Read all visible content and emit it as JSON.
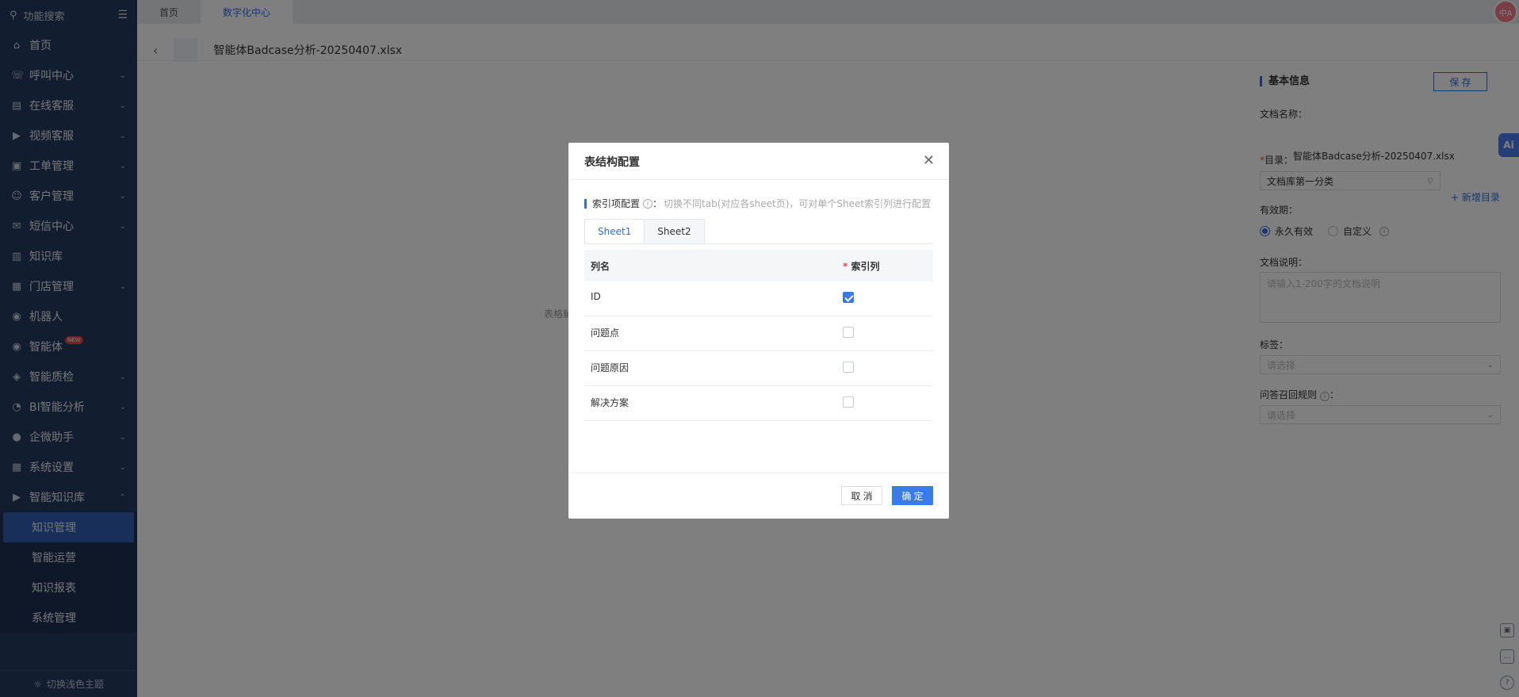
{
  "sidebar": {
    "search_label": "功能搜索",
    "items": [
      {
        "label": "首页",
        "icon": "home-icon",
        "glyph": "⌂",
        "chev": ""
      },
      {
        "label": "呼叫中心",
        "icon": "phone-icon",
        "glyph": "☏",
        "chev": "⌄"
      },
      {
        "label": "在线客服",
        "icon": "chat-icon",
        "glyph": "▤",
        "chev": "⌄"
      },
      {
        "label": "视频客服",
        "icon": "video-icon",
        "glyph": "▶",
        "chev": "⌄"
      },
      {
        "label": "工单管理",
        "icon": "ticket-icon",
        "glyph": "▣",
        "chev": "⌄"
      },
      {
        "label": "客户管理",
        "icon": "users-icon",
        "glyph": "☺",
        "chev": "⌄"
      },
      {
        "label": "短信中心",
        "icon": "mail-icon",
        "glyph": "✉",
        "chev": "⌄"
      },
      {
        "label": "知识库",
        "icon": "books-icon",
        "glyph": "▥",
        "chev": ""
      },
      {
        "label": "门店管理",
        "icon": "store-icon",
        "glyph": "▦",
        "chev": "⌄"
      },
      {
        "label": "机器人",
        "icon": "robot-icon",
        "glyph": "◉",
        "chev": ""
      },
      {
        "label": "智能体",
        "icon": "agent-icon",
        "glyph": "◉",
        "chev": "",
        "badge": "NEW"
      },
      {
        "label": "智能质检",
        "icon": "quality-icon",
        "glyph": "◈",
        "chev": "⌄"
      },
      {
        "label": "BI智能分析",
        "icon": "pie-chart-icon",
        "glyph": "◔",
        "chev": "⌄"
      },
      {
        "label": "企微助手",
        "icon": "wechat-icon",
        "glyph": "●",
        "chev": "⌄"
      },
      {
        "label": "系统设置",
        "icon": "settings-grid-icon",
        "glyph": "▦",
        "chev": "⌄"
      },
      {
        "label": "智能知识库",
        "icon": "knowledge-icon",
        "glyph": "▶",
        "chev": "⌃"
      }
    ],
    "sub_items": [
      {
        "label": "知识管理",
        "active": true
      },
      {
        "label": "智能运营",
        "active": false
      },
      {
        "label": "知识报表",
        "active": false
      },
      {
        "label": "系统管理",
        "active": false
      }
    ],
    "footer_label": "切换浅色主题"
  },
  "tabs": [
    {
      "label": "首页",
      "active": false
    },
    {
      "label": "数字化中心",
      "active": true
    }
  ],
  "avatar_text": "中A",
  "document": {
    "title": "智能体Badcase分析-20250407.xlsx",
    "preview_hint": "表格解"
  },
  "right_panel": {
    "section_title": "基本信息",
    "save_label": "保 存",
    "doc_name_label": "文档名称：",
    "doc_name_value": "智能体Badcase分析-20250407.xlsx",
    "dir_required": "*",
    "dir_label": "目录：",
    "dir_value": "文档库第一分类",
    "add_dir_label": "+ 新增目录",
    "validity_label": "有效期：",
    "validity_options": [
      {
        "label": "永久有效",
        "selected": true
      },
      {
        "label": "自定义",
        "selected": false
      }
    ],
    "desc_label": "文档说明：",
    "desc_placeholder": "请输入1-200字的文档说明",
    "tags_label": "标签：",
    "tags_placeholder": "请选择",
    "rule_label": "问答召回规则",
    "rule_colon": "：",
    "rule_placeholder": "请选择"
  },
  "ai_float_label": "Ai",
  "modal": {
    "title": "表结构配置",
    "config_label": "索引项配置",
    "config_colon": "：",
    "config_hint": "切换不同tab(对应各sheet页)，可对单个Sheet索引列进行配置",
    "sheets": [
      {
        "label": "Sheet1",
        "active": true
      },
      {
        "label": "Sheet2",
        "active": false
      }
    ],
    "col_name_header": "列名",
    "index_required": "*",
    "index_header": "索引列",
    "rows": [
      {
        "name": "ID",
        "checked": true
      },
      {
        "name": "问题点",
        "checked": false
      },
      {
        "name": "问题原因",
        "checked": false
      },
      {
        "name": "解决方案",
        "checked": false
      }
    ],
    "cancel_label": "取 消",
    "ok_label": "确 定"
  },
  "colors": {
    "sidebar_bg": "#243a5e",
    "accent": "#2f6fdb",
    "primary_button": "#3a7be8",
    "required": "#e5484d"
  }
}
